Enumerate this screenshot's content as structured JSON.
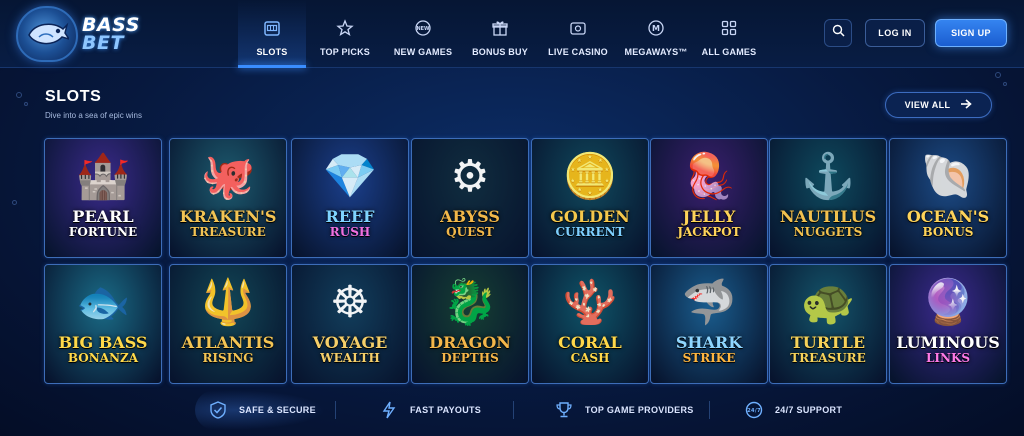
{
  "brand": {
    "line1": "BASS",
    "line2": "BET"
  },
  "nav": [
    {
      "label": "SLOTS",
      "icon": "slot-machine-icon",
      "active": true
    },
    {
      "label": "TOP PICKS",
      "icon": "star-icon",
      "active": false
    },
    {
      "label": "NEW GAMES",
      "icon": "new-badge-icon",
      "active": false
    },
    {
      "label": "BONUS BUY",
      "icon": "gift-icon",
      "active": false
    },
    {
      "label": "LIVE CASINO",
      "icon": "live-camera-icon",
      "active": false
    },
    {
      "label": "MEGAWAYS™",
      "icon": "megaways-m-icon",
      "active": false
    },
    {
      "label": "ALL GAMES",
      "icon": "grid-icon",
      "active": false
    }
  ],
  "header": {
    "login_label": "LOG IN",
    "signup_label": "SIGN UP",
    "search_icon": "search-icon"
  },
  "section": {
    "title": "SLOTS",
    "subtitle": "Dive into a sea of epic wins",
    "view_all_label": "VIEW ALL"
  },
  "games": [
    {
      "line1": "PEARL",
      "line2": "FORTUNE",
      "art": "castle-pearl",
      "color1": "#ffffff",
      "color2": "#ffffff",
      "bg": "#3a2a8a"
    },
    {
      "line1": "KRAKEN'S",
      "line2": "TREASURE",
      "art": "octopus",
      "color1": "#f3c454",
      "color2": "#f3c454",
      "bg": "#1d5a6e"
    },
    {
      "line1": "REEF",
      "line2": "RUSH",
      "art": "diamond",
      "color1": "#7fd4ff",
      "color2": "#f070e0",
      "bg": "#1b3f8c"
    },
    {
      "line1": "ABYSS",
      "line2": "QUEST",
      "art": "submarine",
      "color1": "#f2b84a",
      "color2": "#f2b84a",
      "bg": "#102d3f"
    },
    {
      "line1": "GOLDEN",
      "line2": "CURRENT",
      "art": "treasure-chest",
      "color1": "#f5c84c",
      "color2": "#7ed0ff",
      "bg": "#10485c"
    },
    {
      "line1": "JELLY",
      "line2": "JACKPOT",
      "art": "jellyfish",
      "color1": "#ffd45a",
      "color2": "#ffd45a",
      "bg": "#3a1f6e"
    },
    {
      "line1": "NAUTILUS",
      "line2": "NUGGETS",
      "art": "anchor",
      "color1": "#f2c24f",
      "color2": "#f2c24f",
      "bg": "#0e4a5e"
    },
    {
      "line1": "OCEAN'S",
      "line2": "BONUS",
      "art": "pearl-shell",
      "color1": "#ffd45a",
      "color2": "#ffd45a",
      "bg": "#1c4b86"
    },
    {
      "line1": "BIG BASS",
      "line2": "BONANZA",
      "art": "bass-fish",
      "color1": "#ffd94a",
      "color2": "#ffd94a",
      "bg": "#1a6b86"
    },
    {
      "line1": "ATLANTIS",
      "line2": "RISING",
      "art": "trident",
      "color1": "#f3c454",
      "color2": "#f3c454",
      "bg": "#124656"
    },
    {
      "line1": "VOYAGE",
      "line2": "WEALTH",
      "art": "ship-wheel",
      "color1": "#f6cf6a",
      "color2": "#f6cf6a",
      "bg": "#123e5c"
    },
    {
      "line1": "DRAGON",
      "line2": "DEPTHS",
      "art": "sea-dragon",
      "color1": "#f3b64a",
      "color2": "#f3b64a",
      "bg": "#163f34"
    },
    {
      "line1": "CORAL",
      "line2": "CASH",
      "art": "coral",
      "color1": "#ffd84a",
      "color2": "#ffd84a",
      "bg": "#0f5468"
    },
    {
      "line1": "SHARK",
      "line2": "STRIKE",
      "art": "shark",
      "color1": "#8fd6ff",
      "color2": "#ffb640",
      "bg": "#1a5d8e"
    },
    {
      "line1": "TURTLE",
      "line2": "TREASURE",
      "art": "turtle",
      "color1": "#f5d25a",
      "color2": "#f5d25a",
      "bg": "#14546a"
    },
    {
      "line1": "LUMINOUS",
      "line2": "LINKS",
      "art": "glowing-pearl",
      "color1": "#ffffff",
      "color2": "#ff7ae6",
      "bg": "#3b2a8e"
    }
  ],
  "features": [
    {
      "label": "SAFE & SECURE",
      "icon": "shield-check-icon"
    },
    {
      "label": "FAST PAYOUTS",
      "icon": "lightning-icon"
    },
    {
      "label": "TOP GAME PROVIDERS",
      "icon": "trophy-icon"
    },
    {
      "label": "24/7 SUPPORT",
      "icon": "clock-24-icon"
    }
  ],
  "colors": {
    "accent": "#3a8dff",
    "background": "#07193f",
    "header": "#061634"
  }
}
